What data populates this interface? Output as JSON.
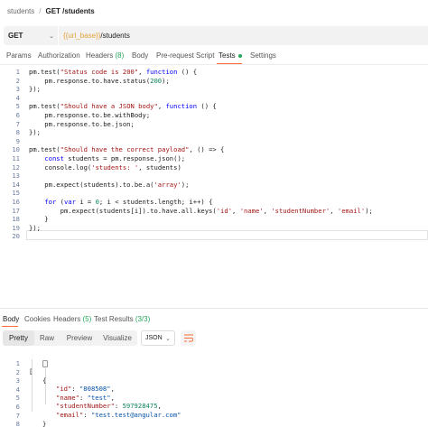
{
  "breadcrumb": {
    "parent": "students",
    "separator": "/",
    "current": "GET /students"
  },
  "request": {
    "method": "GET",
    "url_var": "{{url_base}}",
    "url_path": "/students"
  },
  "request_tabs": [
    {
      "label": "Params"
    },
    {
      "label": "Authorization"
    },
    {
      "label": "Headers",
      "count": "(8)"
    },
    {
      "label": "Body"
    },
    {
      "label": "Pre-request Script"
    },
    {
      "label": "Tests",
      "active": true
    },
    {
      "label": "Settings"
    }
  ],
  "test_script": [
    {
      "no": "1",
      "code": "pm.test(\"Status code is 200\", function () {"
    },
    {
      "no": "2",
      "code": "    pm.response.to.have.status(200);"
    },
    {
      "no": "3",
      "code": "});"
    },
    {
      "no": "4",
      "code": ""
    },
    {
      "no": "5",
      "code": "pm.test(\"Should have a JSON body\", function () {"
    },
    {
      "no": "6",
      "code": "    pm.response.to.be.withBody;"
    },
    {
      "no": "7",
      "code": "    pm.response.to.be.json;"
    },
    {
      "no": "8",
      "code": "});"
    },
    {
      "no": "9",
      "code": ""
    },
    {
      "no": "10",
      "code": "pm.test(\"Should have the correct payload\", () => {"
    },
    {
      "no": "11",
      "code": "    const students = pm.response.json();"
    },
    {
      "no": "12",
      "code": "    console.log('students: ', students)"
    },
    {
      "no": "13",
      "code": ""
    },
    {
      "no": "14",
      "code": "    pm.expect(students).to.be.a('array');"
    },
    {
      "no": "15",
      "code": ""
    },
    {
      "no": "16",
      "code": "    for (var i = 0; i < students.length; i++) {"
    },
    {
      "no": "17",
      "code": "        pm.expect(students[i]).to.have.all.keys('id', 'name', 'studentNumber', 'email');"
    },
    {
      "no": "18",
      "code": "    }"
    },
    {
      "no": "19",
      "code": "});"
    },
    {
      "no": "20",
      "code": ""
    }
  ],
  "response_tabs": [
    {
      "label": "Body",
      "active": true
    },
    {
      "label": "Cookies"
    },
    {
      "label": "Headers",
      "count": "(5)"
    },
    {
      "label": "Test Results",
      "count": "(3/3)"
    }
  ],
  "view_modes": [
    {
      "label": "Pretty",
      "active": true
    },
    {
      "label": "Raw"
    },
    {
      "label": "Preview"
    },
    {
      "label": "Visualize"
    }
  ],
  "format": {
    "selected": "JSON"
  },
  "response_body": {
    "line_numbers": [
      "1",
      "2",
      "3",
      "4",
      "5",
      "6",
      "7",
      "8"
    ],
    "open_array": "[",
    "open_object": "{",
    "fields": [
      {
        "key": "\"id\"",
        "value": "\"808508\""
      },
      {
        "key": "\"name\"",
        "value": "\"test\""
      },
      {
        "key": "\"studentNumber\"",
        "value": "597928475"
      },
      {
        "key": "\"email\"",
        "value": "\"test.test@angular.com\""
      }
    ],
    "close_object": "}",
    "close_array": "]"
  },
  "colors": {
    "accent": "#ff6c37",
    "success": "#26a65b",
    "url_variable": "#e5a23b"
  },
  "icons": [
    "chevron-down-icon",
    "wrap-lines-icon",
    "status-dot-icon"
  ]
}
